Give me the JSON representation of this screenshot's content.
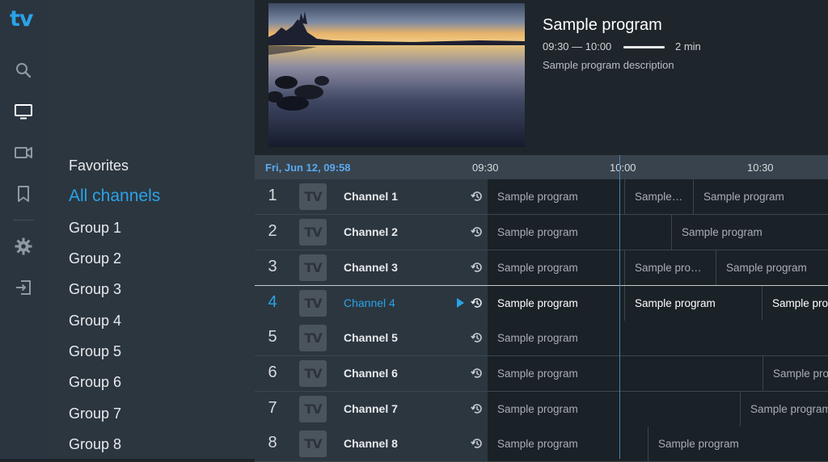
{
  "app": {
    "logo": "tv"
  },
  "rail": [
    {
      "icon": "search-icon"
    },
    {
      "icon": "tv-icon"
    },
    {
      "icon": "video-camera-icon"
    },
    {
      "icon": "bookmark-icon"
    },
    {
      "icon": "gear-icon"
    },
    {
      "icon": "exit-icon"
    }
  ],
  "groups": [
    "Favorites",
    "All channels",
    "Group 1",
    "Group 2",
    "Group 3",
    "Group 4",
    "Group 5",
    "Group 6",
    "Group 7",
    "Group 8"
  ],
  "active_group": "All channels",
  "preview": {
    "title": "Sample program",
    "time": "09:30 — 10:00",
    "duration": "2 min",
    "description": "Sample program description",
    "progress": 0.93
  },
  "timeline": {
    "date": "Fri, Jun 12, 09:58",
    "ticks": [
      "09:30",
      "10:00",
      "10:30"
    ]
  },
  "channels": [
    {
      "num": "1",
      "name": "Channel 1",
      "logo": "TV",
      "programs": [
        "Sample program",
        "Sample program",
        "Sample program"
      ]
    },
    {
      "num": "2",
      "name": "Channel 2",
      "logo": "TV",
      "programs": [
        "Sample program",
        "Sample program"
      ]
    },
    {
      "num": "3",
      "name": "Channel 3",
      "logo": "TV",
      "programs": [
        "Sample program",
        "Sample program",
        "Sample program"
      ]
    },
    {
      "num": "4",
      "name": "Channel 4",
      "logo": "TV",
      "programs": [
        "Sample program",
        "Sample program",
        "Sample program"
      ]
    },
    {
      "num": "5",
      "name": "Channel 5",
      "logo": "TV",
      "programs": [
        "Sample program"
      ]
    },
    {
      "num": "6",
      "name": "Channel 6",
      "logo": "TV",
      "programs": [
        "Sample program",
        "Sample program"
      ]
    },
    {
      "num": "7",
      "name": "Channel 7",
      "logo": "TV",
      "programs": [
        "Sample program",
        "Sample program"
      ]
    },
    {
      "num": "8",
      "name": "Channel 8",
      "logo": "TV",
      "programs": [
        "Sample program",
        "Sample program"
      ]
    }
  ],
  "selected_channel": "Channel 4"
}
